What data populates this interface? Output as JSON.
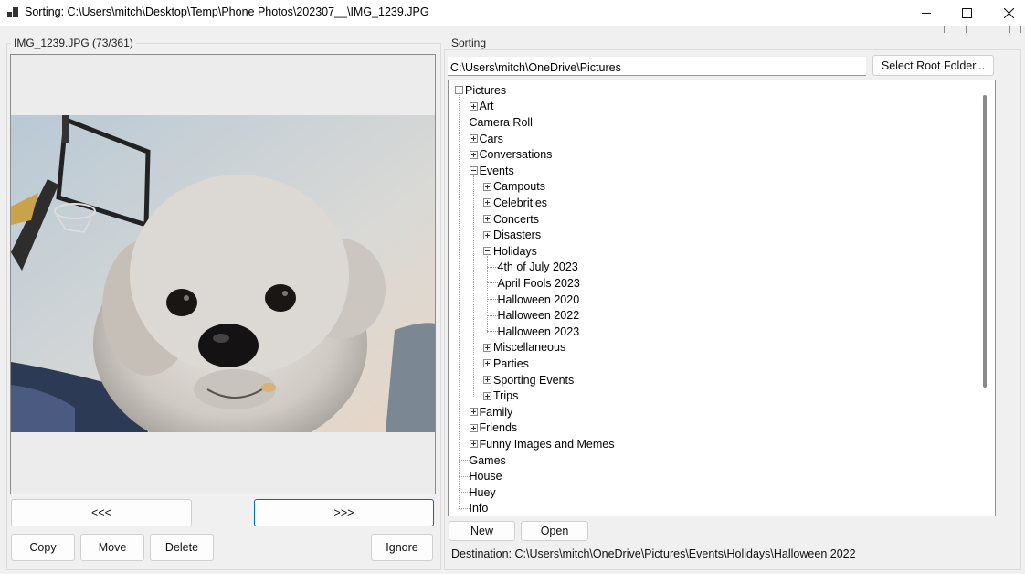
{
  "window": {
    "title": "Sorting: C:\\Users\\mitch\\Desktop\\Temp\\Phone Photos\\202307__\\IMG_1239.JPG",
    "minimize_icon": "minimize-icon",
    "maximize_icon": "maximize-icon",
    "close_icon": "close-icon"
  },
  "image_panel": {
    "group_label": "IMG_1239.JPG (73/361)",
    "photo_description_icon": "dog-photo",
    "prev_label": "<<<",
    "next_label": ">>>",
    "copy_label": "Copy",
    "move_label": "Move",
    "delete_label": "Delete",
    "ignore_label": "Ignore"
  },
  "sorting_panel": {
    "group_label": "Sorting",
    "root_path": "C:\\Users\\mitch\\OneDrive\\Pictures",
    "select_root_label": "Select Root Folder...",
    "tree": [
      {
        "label": "Pictures",
        "level": 0,
        "state": "expanded"
      },
      {
        "label": "Art",
        "level": 1,
        "state": "collapsed"
      },
      {
        "label": "Camera Roll",
        "level": 1,
        "state": "leaf"
      },
      {
        "label": "Cars",
        "level": 1,
        "state": "collapsed"
      },
      {
        "label": "Conversations",
        "level": 1,
        "state": "collapsed"
      },
      {
        "label": "Events",
        "level": 1,
        "state": "expanded"
      },
      {
        "label": "Campouts",
        "level": 2,
        "state": "collapsed"
      },
      {
        "label": "Celebrities",
        "level": 2,
        "state": "collapsed"
      },
      {
        "label": "Concerts",
        "level": 2,
        "state": "collapsed"
      },
      {
        "label": "Disasters",
        "level": 2,
        "state": "collapsed"
      },
      {
        "label": "Holidays",
        "level": 2,
        "state": "expanded"
      },
      {
        "label": "4th of July 2023",
        "level": 3,
        "state": "leaf"
      },
      {
        "label": "April Fools 2023",
        "level": 3,
        "state": "leaf"
      },
      {
        "label": "Halloween 2020",
        "level": 3,
        "state": "leaf"
      },
      {
        "label": "Halloween 2022",
        "level": 3,
        "state": "leaf"
      },
      {
        "label": "Halloween 2023",
        "level": 3,
        "state": "leaf"
      },
      {
        "label": "Miscellaneous",
        "level": 2,
        "state": "collapsed"
      },
      {
        "label": "Parties",
        "level": 2,
        "state": "collapsed"
      },
      {
        "label": "Sporting Events",
        "level": 2,
        "state": "collapsed"
      },
      {
        "label": "Trips",
        "level": 2,
        "state": "collapsed"
      },
      {
        "label": "Family",
        "level": 1,
        "state": "collapsed"
      },
      {
        "label": "Friends",
        "level": 1,
        "state": "collapsed"
      },
      {
        "label": "Funny Images and Memes",
        "level": 1,
        "state": "collapsed"
      },
      {
        "label": "Games",
        "level": 1,
        "state": "leaf"
      },
      {
        "label": "House",
        "level": 1,
        "state": "leaf"
      },
      {
        "label": "Huey",
        "level": 1,
        "state": "leaf"
      },
      {
        "label": "Info",
        "level": 1,
        "state": "leaf"
      }
    ],
    "new_label": "New",
    "open_label": "Open",
    "destination": "Destination: C:\\Users\\mitch\\OneDrive\\Pictures\\Events\\Holidays\\Halloween 2022"
  },
  "colors": {
    "window_bg": "#f0f0f0",
    "focus_border": "#0067c0"
  }
}
